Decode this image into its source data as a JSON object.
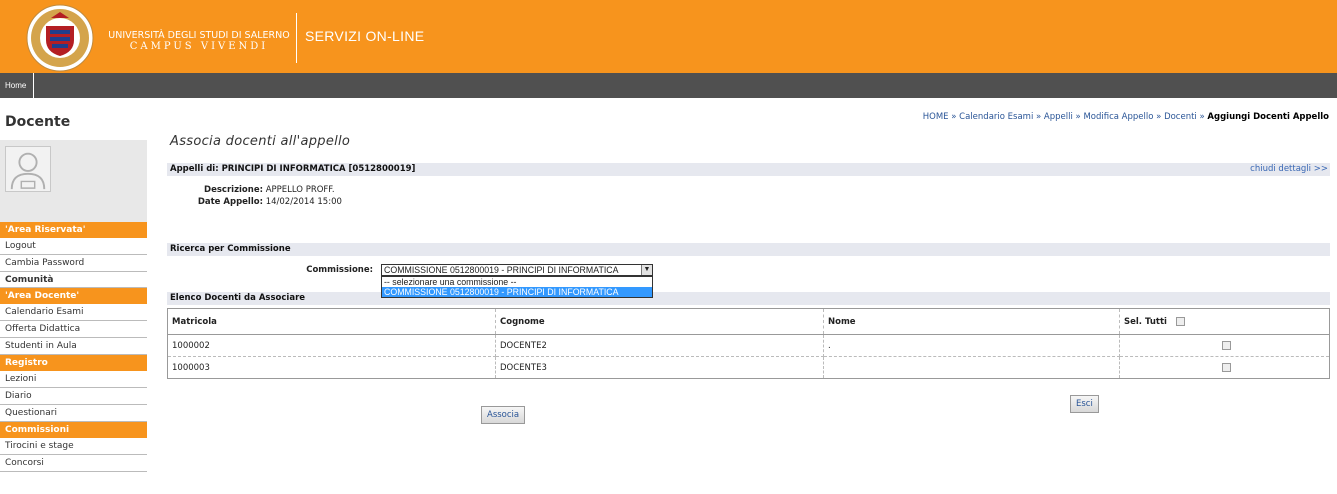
{
  "header": {
    "uni_line1": "UNIVERSITÀ DEGLI STUDI DI SALERNO",
    "uni_line2": "CAMPUS VIVENDI",
    "service": "SERVIZI ON-LINE",
    "colors": {
      "brand": "#f7941d",
      "navbar": "#505050"
    }
  },
  "nav": {
    "home": "Home"
  },
  "sidebar": {
    "title": "Docente",
    "menu": [
      {
        "type": "section",
        "label": "'Area Riservata'"
      },
      {
        "type": "item",
        "label": "Logout"
      },
      {
        "type": "item",
        "label": "Cambia Password"
      },
      {
        "type": "section-white",
        "label": "Comunità"
      },
      {
        "type": "section",
        "label": "'Area Docente'"
      },
      {
        "type": "item",
        "label": "Calendario Esami"
      },
      {
        "type": "item",
        "label": "Offerta Didattica"
      },
      {
        "type": "item",
        "label": "Studenti in Aula"
      },
      {
        "type": "section",
        "label": "Registro"
      },
      {
        "type": "item",
        "label": "Lezioni"
      },
      {
        "type": "item",
        "label": "Diario"
      },
      {
        "type": "item",
        "label": "Questionari"
      },
      {
        "type": "section",
        "label": "Commissioni"
      },
      {
        "type": "item",
        "label": "Tirocini e stage"
      },
      {
        "type": "item",
        "label": "Concorsi"
      }
    ]
  },
  "breadcrumb": {
    "items": [
      "HOME",
      "Calendario Esami",
      "Appelli",
      "Modifica Appello",
      "Docenti"
    ],
    "separator": " » ",
    "current": "Aggiungi Docenti Appello"
  },
  "main": {
    "title": "Associa docenti all'appello",
    "appelli_bar": "Appelli di: PRINCIPI DI INFORMATICA [0512800019]",
    "chiudi": "chiudi dettagli >>",
    "descrizione_label": "Descrizione:",
    "descrizione_value": "APPELLO PROFF.",
    "date_label": "Date Appello:",
    "date_value": "14/02/2014  15:00",
    "ricerca_bar": "Ricerca per Commissione",
    "commissione_label": "Commissione:",
    "commissione_value": "COMMISSIONE 0512800019 - PRINCIPI DI INFORMATICA",
    "dropdown_options": [
      "-- selezionare una commissione --",
      "COMMISSIONE 0512800019 - PRINCIPI DI INFORMATICA"
    ],
    "elenco_bar": "Elenco Docenti da Associare",
    "table": {
      "headers": [
        "Matricola",
        "Cognome",
        "Nome",
        "Sel. Tutti"
      ],
      "rows": [
        {
          "matricola": "1000002",
          "cognome": "DOCENTE2",
          "nome": "."
        },
        {
          "matricola": "1000003",
          "cognome": "DOCENTE3",
          "nome": ""
        }
      ]
    },
    "associa_button": "Associa",
    "esci_button": "Esci"
  }
}
